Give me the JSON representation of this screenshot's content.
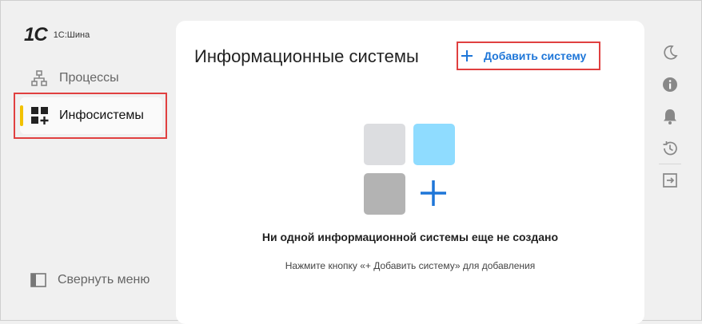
{
  "app": {
    "logo_mark": "1C",
    "product_name": "1С:Шина"
  },
  "sidebar": {
    "items": [
      {
        "label": "Процессы",
        "icon": "hierarchy-icon",
        "active": false
      },
      {
        "label": "Инфосистемы",
        "icon": "grid-plus-icon",
        "active": true
      }
    ],
    "collapse_label": "Свернуть меню",
    "active_accent": "#f2c200"
  },
  "main": {
    "title": "Информационные системы",
    "add_button": {
      "icon": "plus-icon",
      "label": "Добавить систему",
      "color": "#1e76d8"
    },
    "empty_state": {
      "title": "Ни одной информационной системы еще не создано",
      "hint": "Нажмите кнопку «+ Добавить систему» для добавления",
      "tile_colors": [
        "#dcdde0",
        "#8fdcff",
        "#b3b3b3"
      ],
      "plus_color": "#1e76d8"
    }
  },
  "right_rail": {
    "icons": [
      "moon-icon",
      "info-icon",
      "bell-icon",
      "history-icon",
      "logout-icon"
    ]
  },
  "highlight_color": "#e04040"
}
